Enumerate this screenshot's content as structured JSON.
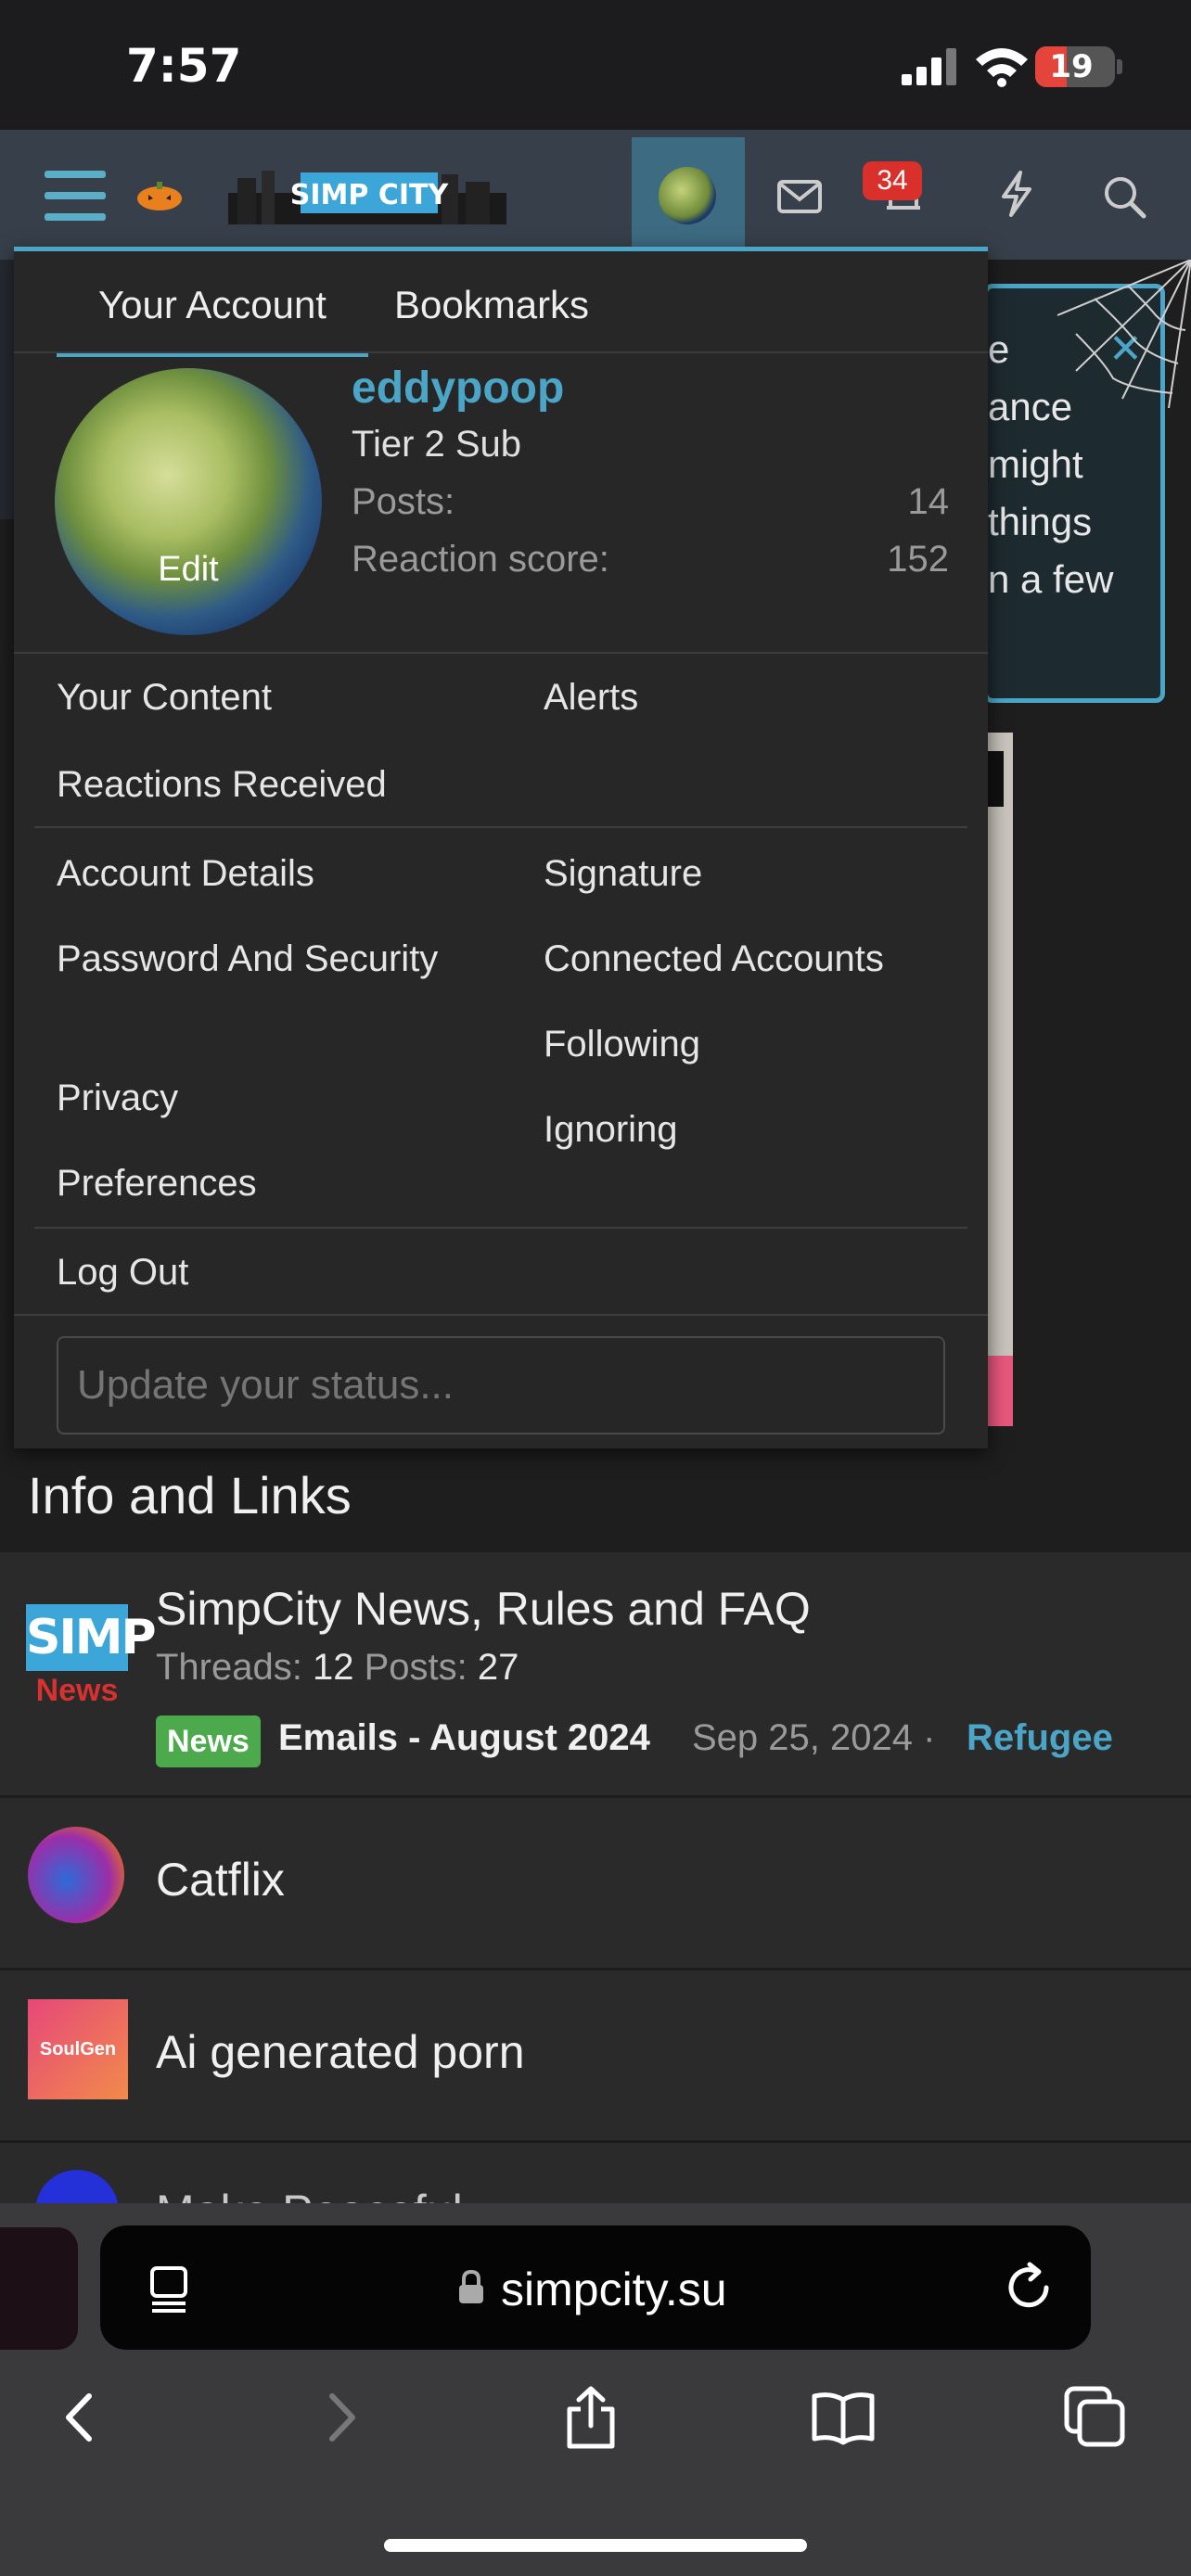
{
  "status_bar": {
    "time": "7:57",
    "battery": "19"
  },
  "header": {
    "notification_count": "34",
    "logo_text": "SIMP CITY"
  },
  "background_notice": {
    "lines": [
      "e",
      "ance",
      "might",
      "things",
      "n a few"
    ]
  },
  "account_menu": {
    "tabs": [
      "Your Account",
      "Bookmarks"
    ],
    "username": "eddypoop",
    "user_title": "Tier 2 Sub",
    "avatar_edit_label": "Edit",
    "stats": [
      {
        "label": "Posts:",
        "value": "14"
      },
      {
        "label": "Reaction score:",
        "value": "152"
      }
    ],
    "group1_left": [
      "Your Content",
      "Reactions Received"
    ],
    "group1_right": [
      "Alerts"
    ],
    "group2_left": [
      "Account Details",
      "Password And Security",
      "Privacy",
      "Preferences"
    ],
    "group2_right": [
      "Signature",
      "Connected Accounts",
      "Following",
      "Ignoring"
    ],
    "logout": "Log Out",
    "status_placeholder": "Update your status..."
  },
  "forum": {
    "section_title": "Info and Links",
    "nodes": [
      {
        "title": "SimpCity News, Rules and FAQ",
        "icon_text": "SIMP",
        "icon_subtext": "News",
        "threads_label": "Threads:",
        "threads": "12",
        "posts_label": "Posts:",
        "posts": "27",
        "latest_tag": "News",
        "latest_title": "Emails - August 2024",
        "latest_date": "Sep 25, 2024 ·",
        "latest_user": "Refugee"
      },
      {
        "title": "Catflix"
      },
      {
        "title": "Ai generated porn",
        "icon_text": "SoulGen"
      },
      {
        "title": "Make Peaceful"
      }
    ]
  },
  "browser": {
    "url": "simpcity.su"
  }
}
